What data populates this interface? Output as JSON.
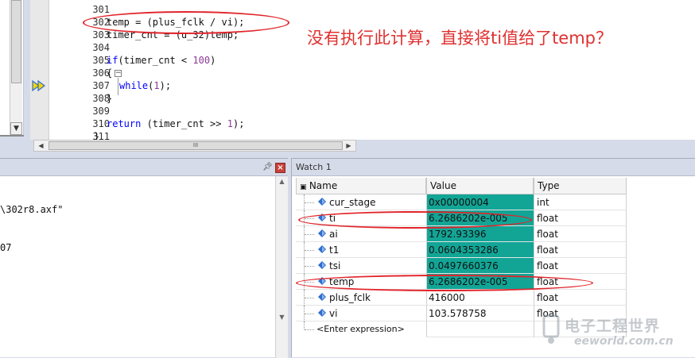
{
  "editor": {
    "lines": [
      {
        "num": "301",
        "code": ""
      },
      {
        "num": "302",
        "code": "temp = (plus_fclk / vi);"
      },
      {
        "num": "303",
        "code": "timer_cnt = (u_32)temp;"
      },
      {
        "num": "304",
        "code": ""
      },
      {
        "num": "305",
        "code": "if(timer_cnt < 100)"
      },
      {
        "num": "306",
        "code": "{"
      },
      {
        "num": "307",
        "code": "while(1);"
      },
      {
        "num": "308",
        "code": "}"
      },
      {
        "num": "309",
        "code": ""
      },
      {
        "num": "310",
        "code": "return (timer_cnt >> 1);"
      },
      {
        "num": "311",
        "code": "}"
      }
    ],
    "annotation": "没有执行此计算，直接将ti值给了temp？",
    "hscroll_grip": "III"
  },
  "output": {
    "lines": [
      "\\302r8.axf\"",
      "07"
    ]
  },
  "watch": {
    "title": "Watch 1",
    "columns": [
      "Name",
      "Value",
      "Type"
    ],
    "rows": [
      {
        "name": "cur_stage",
        "value": "0x00000004",
        "type": "int",
        "changed": true
      },
      {
        "name": "ti",
        "value": "6.2686202e-005",
        "type": "float",
        "changed": true
      },
      {
        "name": "ai",
        "value": "1792.93396",
        "type": "float",
        "changed": true
      },
      {
        "name": "t1",
        "value": "0.0604353286",
        "type": "float",
        "changed": true
      },
      {
        "name": "tsi",
        "value": "0.0497660376",
        "type": "float",
        "changed": true
      },
      {
        "name": "temp",
        "value": "6.2686202e-005",
        "type": "float",
        "changed": true
      },
      {
        "name": "plus_fclk",
        "value": "416000",
        "type": "float",
        "changed": false
      },
      {
        "name": "vi",
        "value": "103.578758",
        "type": "float",
        "changed": false
      }
    ],
    "enter_expression": "<Enter expression>"
  },
  "watermark": {
    "cn": "电子工程世界",
    "en": "eeworld.com.cn"
  },
  "colors": {
    "changed_value_bg": "#12a596",
    "annotation_red": "#e03030",
    "keyword_blue": "#0000ff"
  }
}
